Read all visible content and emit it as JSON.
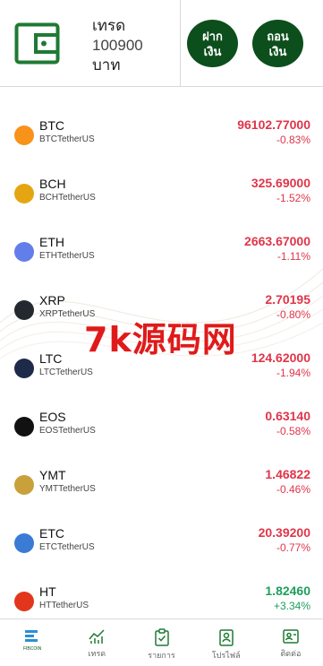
{
  "header": {
    "title": "เทรด",
    "balance": "100900",
    "currency": "บาท",
    "deposit_line1": "ฝาก",
    "deposit_line2": "เงิน",
    "withdraw_line1": "ถอน",
    "withdraw_line2": "เงิน"
  },
  "watermark": "7k源码网",
  "coins": [
    {
      "symbol": "BTC",
      "pair": "BTCTetherUS",
      "price": "96102.77000",
      "change": "-0.83%",
      "trend": "down",
      "icon": "btc-icon",
      "color": "#f7931a"
    },
    {
      "symbol": "BCH",
      "pair": "BCHTetherUS",
      "price": "325.69000",
      "change": "-1.52%",
      "trend": "down",
      "icon": "bch-icon",
      "color": "#e5a512"
    },
    {
      "symbol": "ETH",
      "pair": "ETHTetherUS",
      "price": "2663.67000",
      "change": "-1.11%",
      "trend": "down",
      "icon": "eth-icon",
      "color": "#627eea"
    },
    {
      "symbol": "XRP",
      "pair": "XRPTetherUS",
      "price": "2.70195",
      "change": "-0.80%",
      "trend": "down",
      "icon": "xrp-icon",
      "color": "#23292f"
    },
    {
      "symbol": "LTC",
      "pair": "LTCTetherUS",
      "price": "124.62000",
      "change": "-1.94%",
      "trend": "down",
      "icon": "ltc-icon",
      "color": "#1d2a4a"
    },
    {
      "symbol": "EOS",
      "pair": "EOSTetherUS",
      "price": "0.63140",
      "change": "-0.58%",
      "trend": "down",
      "icon": "eos-icon",
      "color": "#111111"
    },
    {
      "symbol": "YMT",
      "pair": "YMTTetherUS",
      "price": "1.46822",
      "change": "-0.46%",
      "trend": "down",
      "icon": "ymt-icon",
      "color": "#c9a13a"
    },
    {
      "symbol": "ETC",
      "pair": "ETCTetherUS",
      "price": "20.39200",
      "change": "-0.77%",
      "trend": "down",
      "icon": "etc-icon",
      "color": "#3a7bd5"
    },
    {
      "symbol": "HT",
      "pair": "HTTetherUS",
      "price": "1.82460",
      "change": "+3.34%",
      "trend": "up",
      "icon": "ht-icon",
      "color": "#e2361c"
    }
  ],
  "tabs": [
    {
      "label": "FIBCOIN",
      "icon": "logo-icon"
    },
    {
      "label": "เทรด",
      "icon": "chart-icon"
    },
    {
      "label": "รายการ",
      "icon": "clipboard-check-icon"
    },
    {
      "label": "โปรไฟล์",
      "icon": "profile-badge-icon"
    },
    {
      "label": "ติดต่อ",
      "icon": "contact-card-icon"
    }
  ],
  "colors": {
    "brand": "#0c4f1c",
    "down": "#e0354a",
    "up": "#1e9e5c"
  }
}
